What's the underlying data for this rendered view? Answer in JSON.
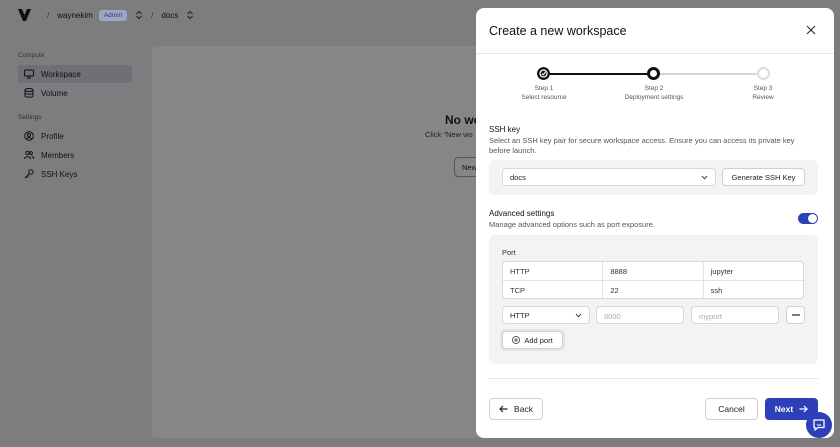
{
  "header": {
    "user": "waynekim",
    "role_badge": "Admin",
    "separator": "/",
    "project": "docs"
  },
  "sidebar": {
    "compute_label": "Compute",
    "compute_items": [
      {
        "label": "Workspace",
        "icon": "monitor-icon"
      },
      {
        "label": "Volume",
        "icon": "database-icon"
      }
    ],
    "settings_label": "Settings",
    "settings_items": [
      {
        "label": "Profile",
        "icon": "user-circle-icon"
      },
      {
        "label": "Members",
        "icon": "users-icon"
      },
      {
        "label": "SSH Keys",
        "icon": "key-icon"
      }
    ]
  },
  "background": {
    "empty_title": "No wo",
    "empty_subtitle": "Click \"New wo",
    "new_button": "New"
  },
  "modal": {
    "title": "Create a new workspace",
    "steps": [
      {
        "step": "Step 1",
        "label": "Select resource",
        "state": "completed"
      },
      {
        "step": "Step 2",
        "label": "Deployment settings",
        "state": "current"
      },
      {
        "step": "Step 3",
        "label": "Review",
        "state": "upcoming"
      }
    ],
    "ssh": {
      "title": "SSH key",
      "description": "Select an SSH key pair for secure workspace access. Ensure you can access its private key before launch.",
      "selected_key": "docs",
      "generate_label": "Generate SSH Key"
    },
    "advanced": {
      "title": "Advanced settings",
      "description": "Manage advanced options such as port exposure.",
      "enabled": true
    },
    "ports": {
      "label": "Port",
      "rows": [
        [
          "HTTP",
          "8888",
          "jupyter"
        ],
        [
          "TCP",
          "22",
          "ssh"
        ]
      ],
      "protocol_value": "HTTP",
      "port_placeholder": "8000",
      "name_placeholder": "myport",
      "add_label": "Add port"
    },
    "footer": {
      "back_label": "Back",
      "cancel_label": "Cancel",
      "next_label": "Next"
    }
  },
  "colors": {
    "primary": "#2c41b8",
    "overlay": "#7d7d80",
    "step_done": "#111111",
    "step_upcoming": "#d6d6d8"
  }
}
